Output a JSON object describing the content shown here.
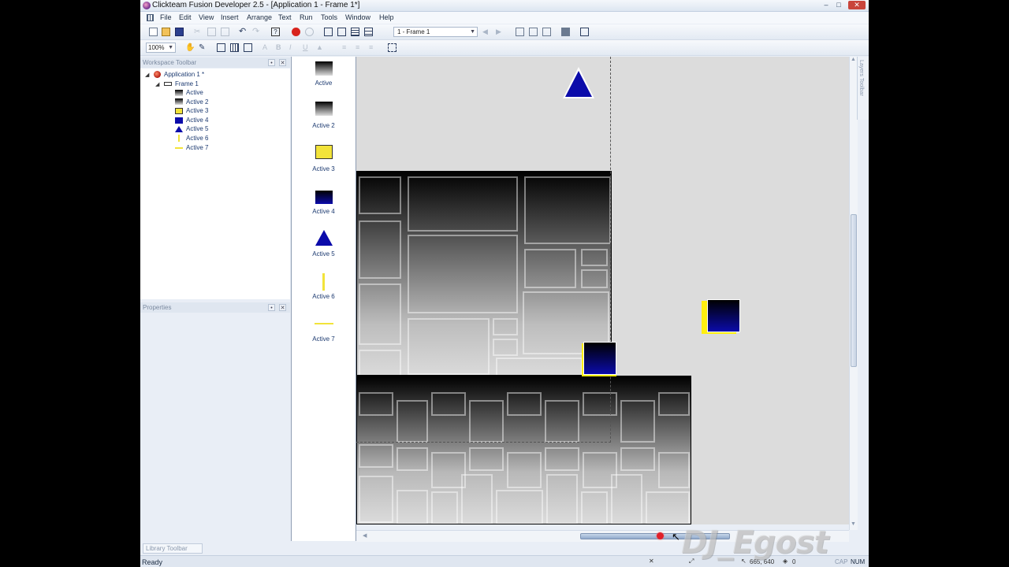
{
  "window": {
    "title": "Clickteam Fusion Developer 2.5 - [Application 1 - Frame 1*]"
  },
  "menu": [
    "File",
    "Edit",
    "View",
    "Insert",
    "Arrange",
    "Text",
    "Run",
    "Tools",
    "Window",
    "Help"
  ],
  "toolbar": {
    "frame_select": "1 - Frame 1",
    "zoom": "100%"
  },
  "workspace": {
    "header": "Workspace Toolbar",
    "app": "Application 1 *",
    "frame": "Frame 1",
    "objects": [
      "Active",
      "Active 2",
      "Active 3",
      "Active 4",
      "Active 5",
      "Active 6",
      "Active 7"
    ]
  },
  "properties": {
    "header": "Properties"
  },
  "library": {
    "tab": "Library Toolbar"
  },
  "layers": {
    "tab": "Layers Toolbar"
  },
  "object_panel": [
    "Active",
    "Active 2",
    "Active 3",
    "Active 4",
    "Active 5",
    "Active 6",
    "Active 7"
  ],
  "status": {
    "ready": "Ready",
    "coords": "665, 640",
    "layer": "0",
    "cap": "CAP",
    "num": "NUM"
  },
  "watermark": "DJ_Egost",
  "colors": {
    "accent_blue": "#0b0baa",
    "yellow": "#ffee10",
    "canvas": "#dcdcdc"
  }
}
